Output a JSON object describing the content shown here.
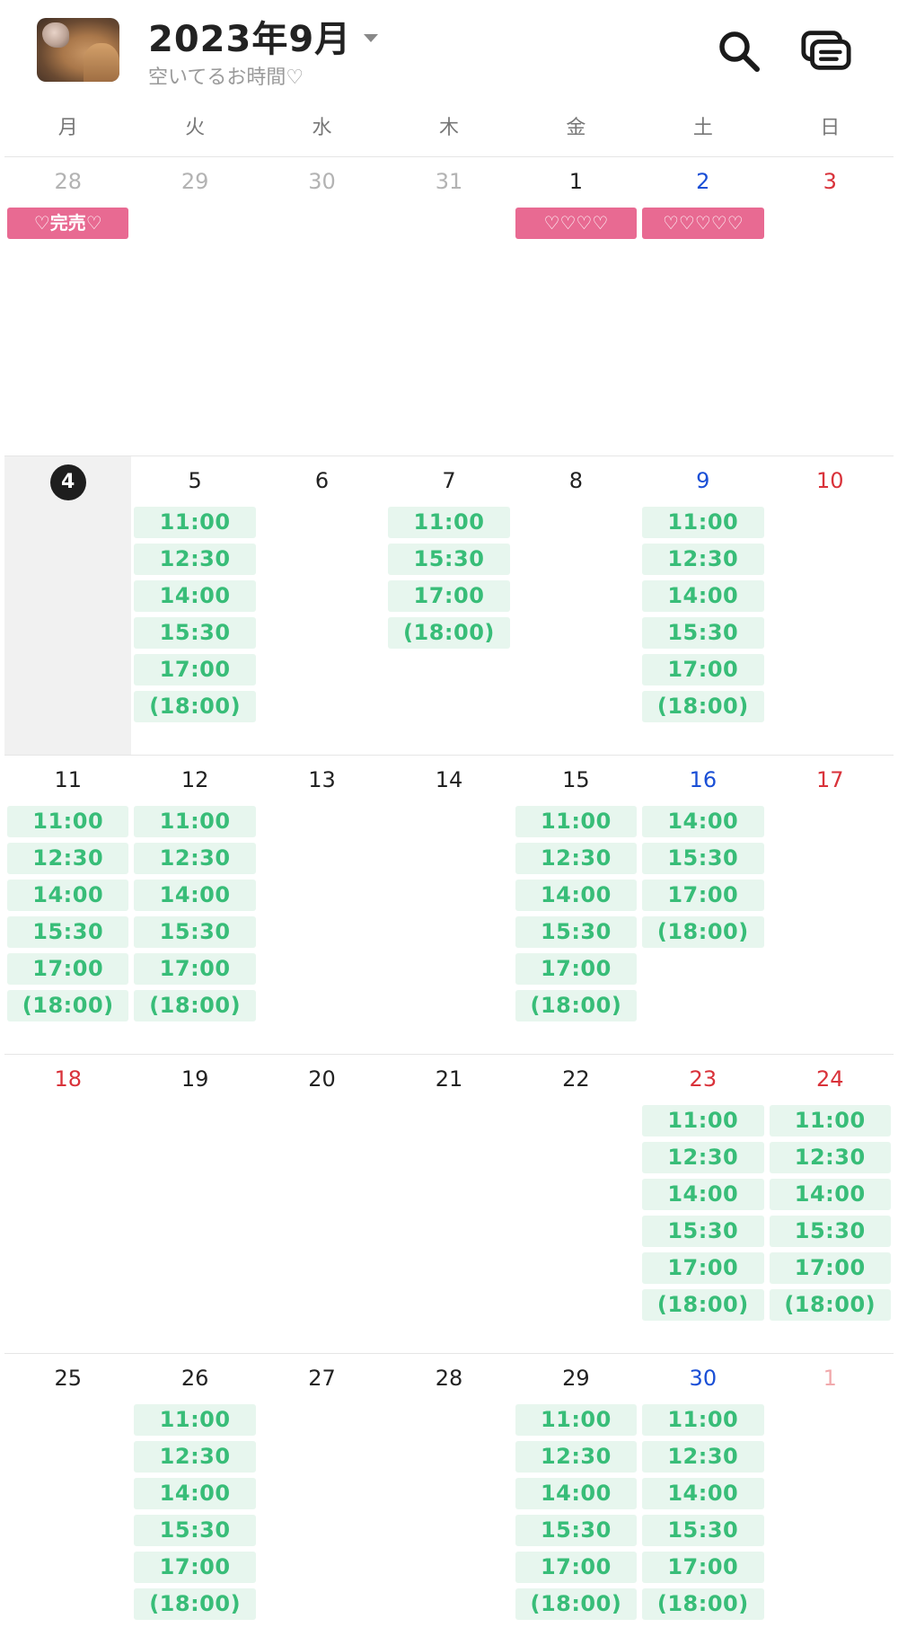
{
  "header": {
    "title": "2023年9月",
    "subtitle": "空いてるお時間♡",
    "icons": [
      "search-icon",
      "chat-bubbles-icon"
    ]
  },
  "weekdays": [
    "月",
    "火",
    "水",
    "木",
    "金",
    "土",
    "日"
  ],
  "colors": {
    "slot_bg": "#e7f6ee",
    "slot_text": "#38bd78",
    "pink": "#e86a92",
    "saturday": "#1a4fd6",
    "sunday": "#d9323a",
    "today_badge": "#1e1e1e"
  },
  "weeks": [
    [
      {
        "num": "28",
        "muted": true,
        "events": [
          "♡完売♡"
        ]
      },
      {
        "num": "29",
        "muted": true,
        "events": []
      },
      {
        "num": "30",
        "muted": true,
        "events": []
      },
      {
        "num": "31",
        "muted": true,
        "events": []
      },
      {
        "num": "1",
        "events": [
          "♡♡♡♡"
        ]
      },
      {
        "num": "2",
        "events": [
          "♡♡♡♡♡"
        ]
      },
      {
        "num": "3",
        "events": []
      }
    ],
    [
      {
        "num": "4",
        "today": true,
        "events": []
      },
      {
        "num": "5",
        "events": [
          "11:00",
          "12:30",
          "14:00",
          "15:30",
          "17:00",
          "(18:00)"
        ]
      },
      {
        "num": "6",
        "events": []
      },
      {
        "num": "7",
        "events": [
          "11:00",
          "15:30",
          "17:00",
          "(18:00)"
        ]
      },
      {
        "num": "8",
        "events": []
      },
      {
        "num": "9",
        "events": [
          "11:00",
          "12:30",
          "14:00",
          "15:30",
          "17:00",
          "(18:00)"
        ]
      },
      {
        "num": "10",
        "events": []
      }
    ],
    [
      {
        "num": "11",
        "events": [
          "11:00",
          "12:30",
          "14:00",
          "15:30",
          "17:00",
          "(18:00)"
        ]
      },
      {
        "num": "12",
        "events": [
          "11:00",
          "12:30",
          "14:00",
          "15:30",
          "17:00",
          "(18:00)"
        ]
      },
      {
        "num": "13",
        "events": []
      },
      {
        "num": "14",
        "events": []
      },
      {
        "num": "15",
        "events": [
          "11:00",
          "12:30",
          "14:00",
          "15:30",
          "17:00",
          "(18:00)"
        ]
      },
      {
        "num": "16",
        "events": [
          "14:00",
          "15:30",
          "17:00",
          "(18:00)"
        ]
      },
      {
        "num": "17",
        "events": []
      }
    ],
    [
      {
        "num": "18",
        "holiday": true,
        "events": []
      },
      {
        "num": "19",
        "events": []
      },
      {
        "num": "20",
        "events": []
      },
      {
        "num": "21",
        "events": []
      },
      {
        "num": "22",
        "events": []
      },
      {
        "num": "23",
        "holiday": true,
        "events": [
          "11:00",
          "12:30",
          "14:00",
          "15:30",
          "17:00",
          "(18:00)"
        ]
      },
      {
        "num": "24",
        "events": [
          "11:00",
          "12:30",
          "14:00",
          "15:30",
          "17:00",
          "(18:00)"
        ]
      }
    ],
    [
      {
        "num": "25",
        "events": []
      },
      {
        "num": "26",
        "events": [
          "11:00",
          "12:30",
          "14:00",
          "15:30",
          "17:00",
          "(18:00)"
        ]
      },
      {
        "num": "27",
        "events": []
      },
      {
        "num": "28",
        "events": []
      },
      {
        "num": "29",
        "events": [
          "11:00",
          "12:30",
          "14:00",
          "15:30",
          "17:00",
          "(18:00)"
        ]
      },
      {
        "num": "30",
        "events": [
          "11:00",
          "12:30",
          "14:00",
          "15:30",
          "17:00",
          "(18:00)"
        ]
      },
      {
        "num": "1",
        "muted": true,
        "events": []
      }
    ]
  ]
}
